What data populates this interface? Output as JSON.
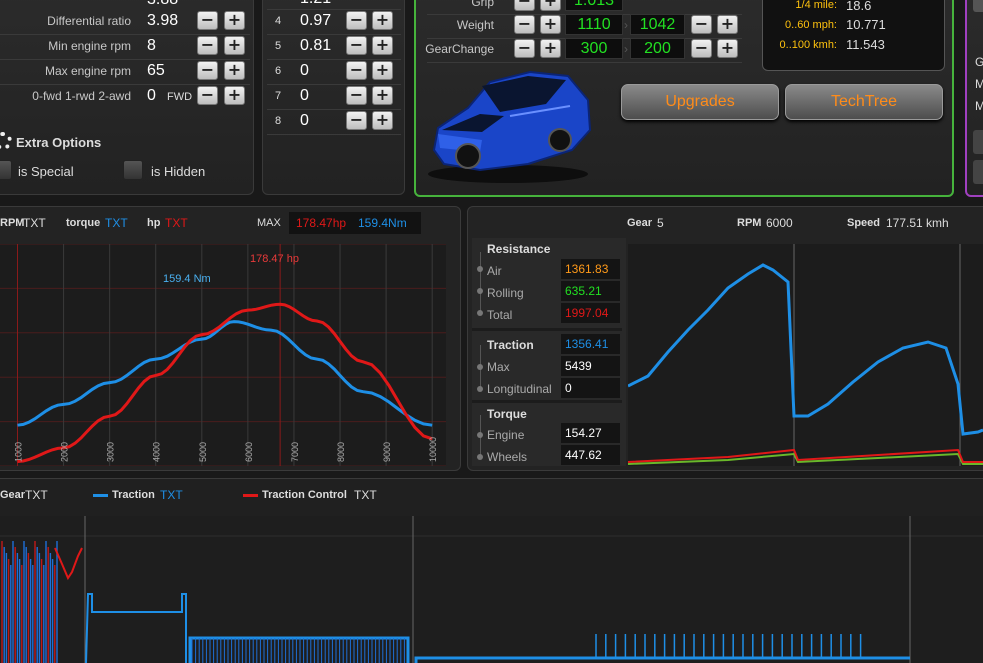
{
  "engine": {
    "rows": [
      {
        "label": "Differential ratio",
        "value": "3.98"
      },
      {
        "label": "Min engine rpm",
        "value": "8"
      },
      {
        "label": "Max engine rpm",
        "value": "65"
      },
      {
        "label": "0-fwd 1-rwd 2-awd",
        "value": "0",
        "tag": "FWD"
      }
    ],
    "top_partial_value": "3.88"
  },
  "extra": {
    "title": "Extra Options",
    "special": "is Special",
    "hidden": "is Hidden"
  },
  "gears": {
    "top_partial": "1.21",
    "rows": [
      {
        "n": "4",
        "v": "0.97"
      },
      {
        "n": "5",
        "v": "0.81"
      },
      {
        "n": "6",
        "v": "0"
      },
      {
        "n": "7",
        "v": "0"
      },
      {
        "n": "8",
        "v": "0"
      }
    ]
  },
  "car": {
    "grip": {
      "label": "Grip",
      "a": "1.013"
    },
    "weight": {
      "label": "Weight",
      "a": "1110",
      "b": "1042"
    },
    "gearchange": {
      "label": "GearChange",
      "a": "300",
      "b": "200"
    },
    "upgrades": "Upgrades",
    "techtree": "TechTree"
  },
  "times": [
    {
      "label": "1/4 mile:",
      "value": "18.6"
    },
    {
      "label": "0..60 mph:",
      "value": "10.771"
    },
    {
      "label": "0..100 kmh:",
      "value": "11.543"
    }
  ],
  "right_edge": [
    "G",
    "M",
    "M"
  ],
  "dyno": {
    "legend": {
      "rpm": "RPM",
      "rpm_txt": "TXT",
      "torque": "torque",
      "torque_txt": "TXT",
      "hp": "hp",
      "hp_txt": "TXT",
      "max": "MAX",
      "max_hp": "178.47hp",
      "max_nm": "159.4Nm"
    },
    "torque_label": "159.4 Nm",
    "hp_label": "178.47 hp",
    "xticks": [
      "1000",
      "2000",
      "3000",
      "4000",
      "5000",
      "6000",
      "7000",
      "8000",
      "9000",
      "10000"
    ]
  },
  "sim": {
    "gear_label": "Gear",
    "gear": "5",
    "rpm_label": "RPM",
    "rpm": "6000",
    "speed_label": "Speed",
    "speed": "177.51 kmh",
    "resistance": {
      "title": "Resistance",
      "air_l": "Air",
      "air": "1361.83",
      "roll_l": "Rolling",
      "roll": "635.21",
      "total_l": "Total",
      "total": "1997.04"
    },
    "traction": {
      "title": "Traction",
      "val": "1356.41",
      "max_l": "Max",
      "max": "5439",
      "long_l": "Longitudinal",
      "long": "0"
    },
    "torque": {
      "title": "Torque",
      "eng_l": "Engine",
      "eng": "154.27",
      "wh_l": "Wheels",
      "wh": "447.62"
    }
  },
  "bottom": {
    "gear": "Gear",
    "gear_txt": "TXT",
    "traction": "Traction",
    "traction_txt": "TXT",
    "tc": "Traction Control",
    "tc_txt": "TXT"
  },
  "colors": {
    "accent": "#ffc20e",
    "torque": "#1e8fe6",
    "hp": "#e01818",
    "green": "#22e022",
    "orange": "#ff8c1a"
  },
  "chart_data": [
    {
      "type": "line",
      "xlabel": "",
      "ylabel": "",
      "series": [
        {
          "name": "torque",
          "x": [
            1000,
            2000,
            3000,
            4000,
            5000,
            5700,
            6500,
            7500,
            8500,
            10000
          ],
          "values": [
            45,
            68,
            92,
            118,
            140,
            159.4,
            150,
            118,
            82,
            45
          ]
        },
        {
          "name": "hp",
          "x": [
            1000,
            2000,
            3000,
            4000,
            5000,
            6000,
            6700,
            7500,
            8500,
            10000
          ],
          "values": [
            5,
            20,
            55,
            100,
            145,
            172,
            178.47,
            160,
            115,
            30
          ]
        }
      ]
    }
  ]
}
